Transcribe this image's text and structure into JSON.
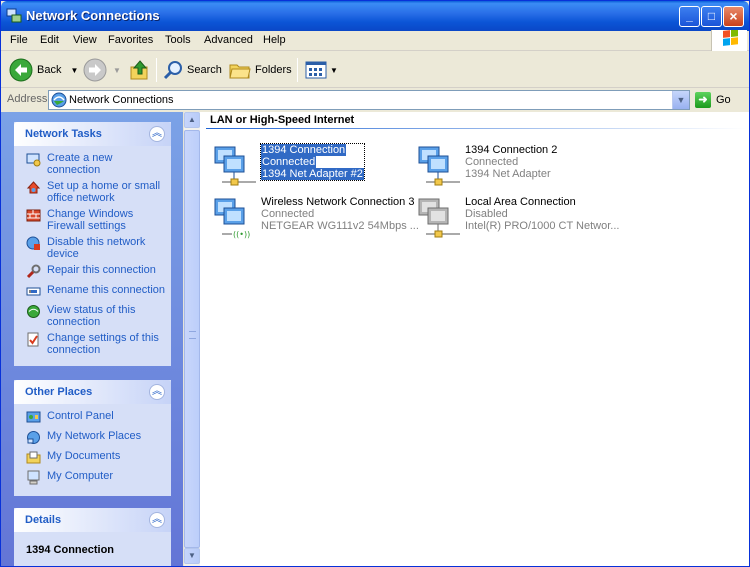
{
  "window": {
    "title": "Network Connections"
  },
  "menu": [
    "File",
    "Edit",
    "View",
    "Favorites",
    "Tools",
    "Advanced",
    "Help"
  ],
  "toolbar": {
    "back": "Back",
    "search": "Search",
    "folders": "Folders"
  },
  "address": {
    "label": "Address",
    "value": "Network Connections",
    "go": "Go"
  },
  "network_tasks": {
    "title": "Network Tasks",
    "items": [
      "Create a new connection",
      "Set up a home or small office network",
      "Change Windows Firewall settings",
      "Disable this network device",
      "Repair this connection",
      "Rename this connection",
      "View status of this connection",
      "Change settings of this connection"
    ]
  },
  "other_places": {
    "title": "Other Places",
    "items": [
      "Control Panel",
      "My Network Places",
      "My Documents",
      "My Computer"
    ]
  },
  "details": {
    "title": "Details",
    "selected_name": "1394 Connection"
  },
  "group": {
    "title": "LAN or High-Speed Internet"
  },
  "connections": [
    {
      "name": "1394 Connection",
      "status": "Connected",
      "device": "1394 Net Adapter #2"
    },
    {
      "name": "1394 Connection 2",
      "status": "Connected",
      "device": "1394 Net Adapter"
    },
    {
      "name": "Wireless Network Connection 3",
      "status": "Connected",
      "device": "NETGEAR WG111v2 54Mbps ..."
    },
    {
      "name": "Local Area Connection",
      "status": "Disabled",
      "device": "Intel(R) PRO/1000 CT Networ..."
    }
  ],
  "colors": {
    "title_bar": "#0a5fd8",
    "link": "#215dc6",
    "selection": "#316ac5"
  }
}
